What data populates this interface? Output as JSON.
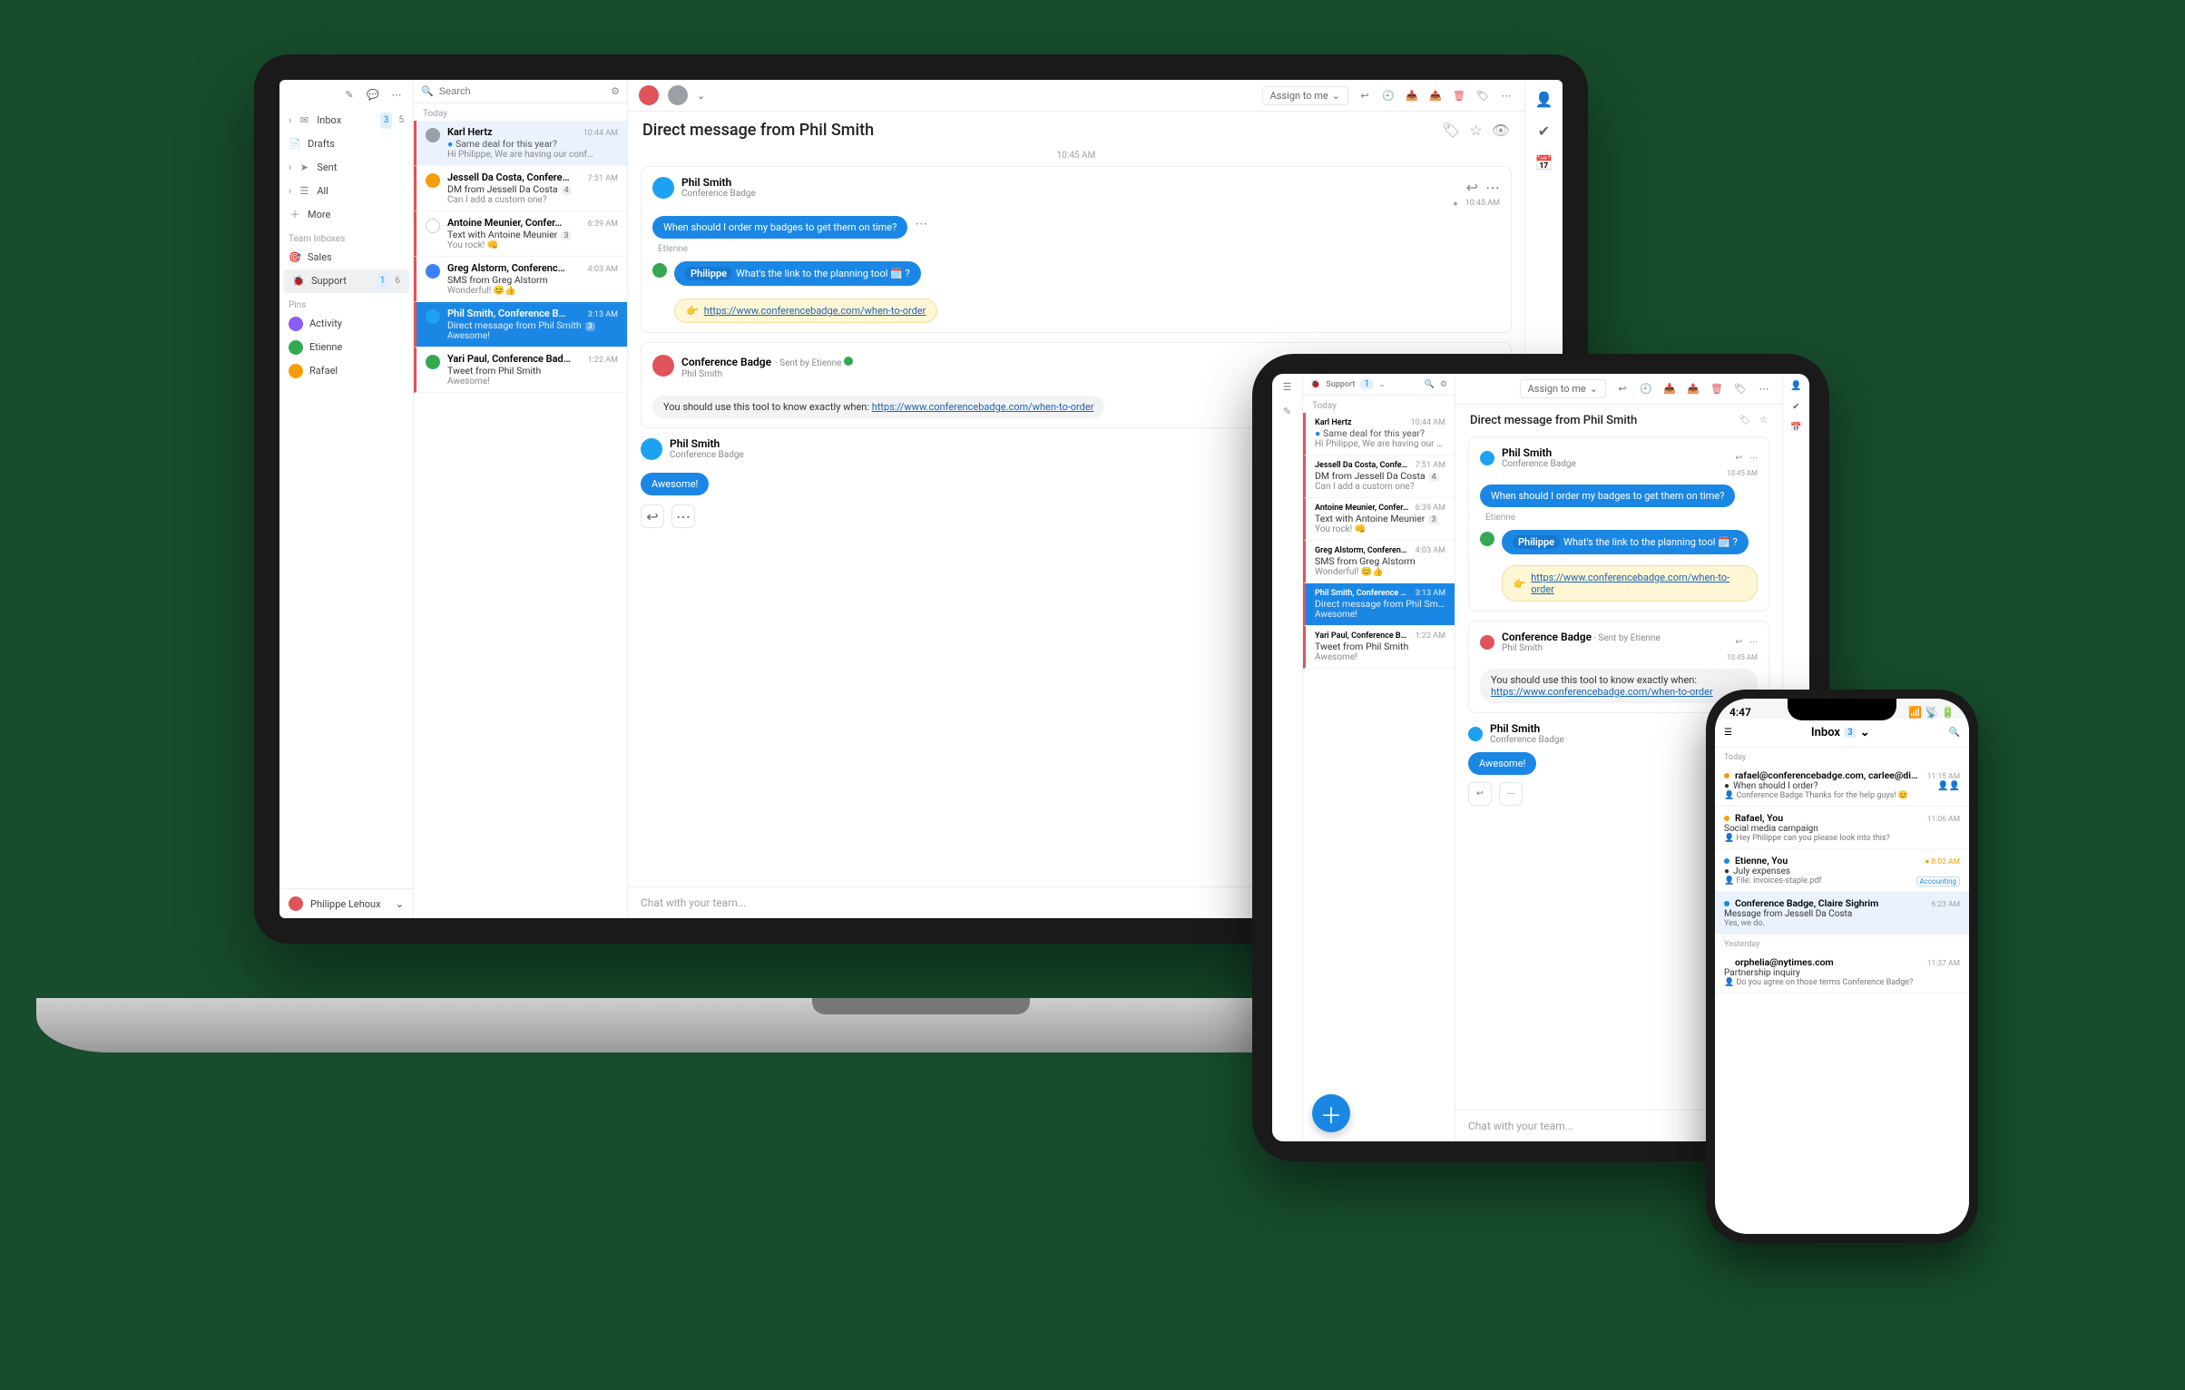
{
  "search_placeholder": "Search",
  "assign_label": "Assign to me",
  "chat_placeholder": "Chat with your team...",
  "today_label": "Today",
  "yesterday_label": "Yesterday",
  "timestamp_center": "10:45 AM",
  "conversation_title": "Direct message from Phil Smith",
  "sidebar": {
    "inbox": {
      "label": "Inbox",
      "c1": "3",
      "c2": "5"
    },
    "drafts": {
      "label": "Drafts"
    },
    "sent": {
      "label": "Sent"
    },
    "all": {
      "label": "All"
    },
    "more": {
      "label": "More"
    },
    "team_head": "Team Inboxes",
    "sales": {
      "label": "Sales"
    },
    "support": {
      "label": "Support",
      "c1": "1",
      "c2": "6"
    },
    "pins_head": "Pins",
    "activity": {
      "label": "Activity"
    },
    "etienne": {
      "label": "Etienne"
    },
    "rafael": {
      "label": "Rafael"
    },
    "user": "Philippe Lehoux"
  },
  "convos": [
    {
      "from": "Karl Hertz",
      "time": "10:44 AM",
      "sub": "Same deal for this year?",
      "prev": "Hi Philippe, We are having our conf…"
    },
    {
      "from": "Jessell Da Costa, Confere…",
      "time": "7:51 AM",
      "sub": "DM from Jessell Da Costa",
      "prev": "Can I add a custom one?",
      "badge": "4"
    },
    {
      "from": "Antoine Meunier, Confer…",
      "time": "6:39 AM",
      "sub": "Text with Antoine Meunier",
      "prev": "You rock! 👊",
      "badge": "3"
    },
    {
      "from": "Greg Alstorm, Conferenc…",
      "time": "4:03 AM",
      "sub": "SMS from Greg Alstorm",
      "prev": "Wonderful! 😊👍"
    },
    {
      "from": "Phil Smith, Conference B…",
      "time": "3:13 AM",
      "sub": "Direct message from Phil Smith",
      "prev": "Awesome!",
      "badge": "3"
    },
    {
      "from": "Yari Paul, Conference Bad…",
      "time": "1:22 AM",
      "sub": "Tweet from Phil Smith",
      "prev": "Awesome!"
    }
  ],
  "msg1": {
    "name": "Phil Smith",
    "sub": "Conference Badge",
    "time": "10:45 AM",
    "bubble": "When should I order my badges to get them on time?"
  },
  "inline": {
    "author": "Etienne",
    "chip": "Philippe",
    "text": "What's the link to the planning tool 🗓️ ?",
    "link": "https://www.conferencebadge.com/when-to-order"
  },
  "msg2": {
    "name": "Conference Badge",
    "meta": "Sent by Etienne",
    "sub": "Phil Smith",
    "time": "10:45 AM",
    "body_pre": "You should use this tool to know exactly when: ",
    "body_link": "https://www.conferencebadge.com/when-to-order"
  },
  "msg3": {
    "name": "Phil Smith",
    "sub": "Conference Badge",
    "bubble": "Awesome!"
  },
  "ipad_support": {
    "label": "Support",
    "count": "1"
  },
  "phone": {
    "clock": "4:47",
    "title": "Inbox",
    "count": "3",
    "rows": [
      {
        "from": "rafael@conferencebadge.com, carlee@disney…",
        "time": "11:15 AM",
        "sub": "When should I order?",
        "prev": "Conference Badge Thanks for the help guys! 😊",
        "avs": 2
      },
      {
        "from": "Rafael, You",
        "time": "11:06 AM",
        "sub": "Social media campaign",
        "prev": "Hey Philippe can you please look into this?",
        "dot": "orn"
      },
      {
        "from": "Etienne, You",
        "time": "8:02 AM",
        "sub": "July expenses",
        "prev": "File: invoices-staple.pdf",
        "tag": "Accounting",
        "dot": "blue",
        "torange": true
      },
      {
        "from": "Conference Badge, Claire Sighrim",
        "time": "6:23 AM",
        "sub": "Message from Jessell Da Costa",
        "prev": "Yes, we do.",
        "dot": "blue",
        "sel": true,
        "av": 1
      },
      {
        "from": "orphelia@nytimes.com",
        "time": "11:37 AM",
        "sub": "Partnership inquiry",
        "prev": "Do you agree on those terms Conference Badge?"
      }
    ]
  }
}
